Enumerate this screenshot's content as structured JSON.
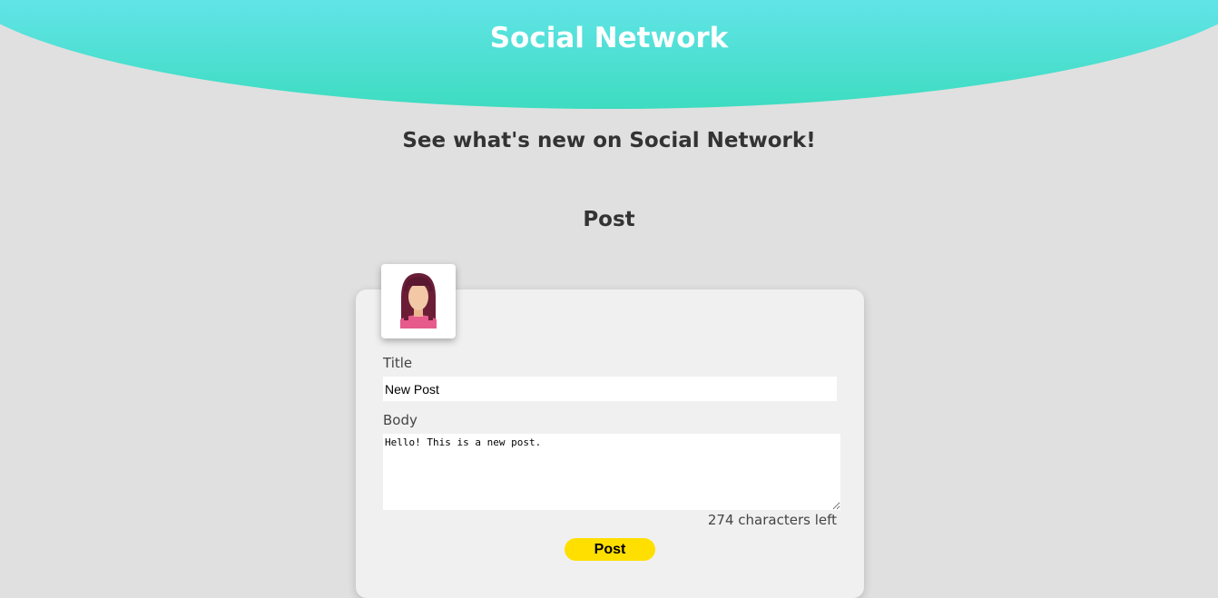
{
  "header": {
    "title": "Social Network"
  },
  "subtitle": "See what's new on Social Network!",
  "section_title": "Post",
  "form": {
    "title_label": "Title",
    "title_value": "New Post",
    "body_label": "Body",
    "body_value": "Hello! This is a new post.",
    "chars_left": "274 characters left",
    "submit_label": "Post"
  },
  "avatar": {
    "icon": "female-user-avatar-icon"
  },
  "colors": {
    "background": "#e0e0e0",
    "header_top": "#68e5ee",
    "header_bottom": "#3ddcc0",
    "card": "#f0f0f0",
    "button": "#ffdf00"
  }
}
